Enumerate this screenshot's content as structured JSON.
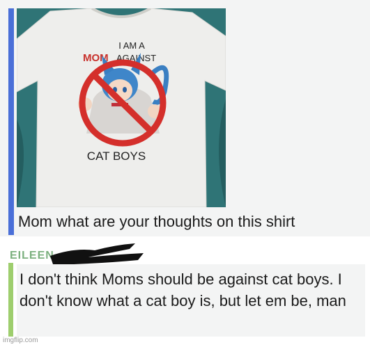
{
  "post": {
    "shirt_text": {
      "line1": "I AM A",
      "line2_emph": "MOM",
      "line2_rest": "AGAINST",
      "line3": "CAT BOYS"
    },
    "caption": "Mom what are your thoughts on this shirt"
  },
  "reply": {
    "author": "EILEEN",
    "text": "I don't think Moms should be against cat boys. I don't know what a cat boy is, but let em be, man"
  },
  "watermark": "imgflip.com",
  "colors": {
    "quote_bar_blue": "#4a6fd8",
    "quote_bar_green": "#9ece6e",
    "author_green": "#7bb07e",
    "shirt_mom_red": "#c8312c",
    "no_symbol_red": "#d42f2b"
  }
}
